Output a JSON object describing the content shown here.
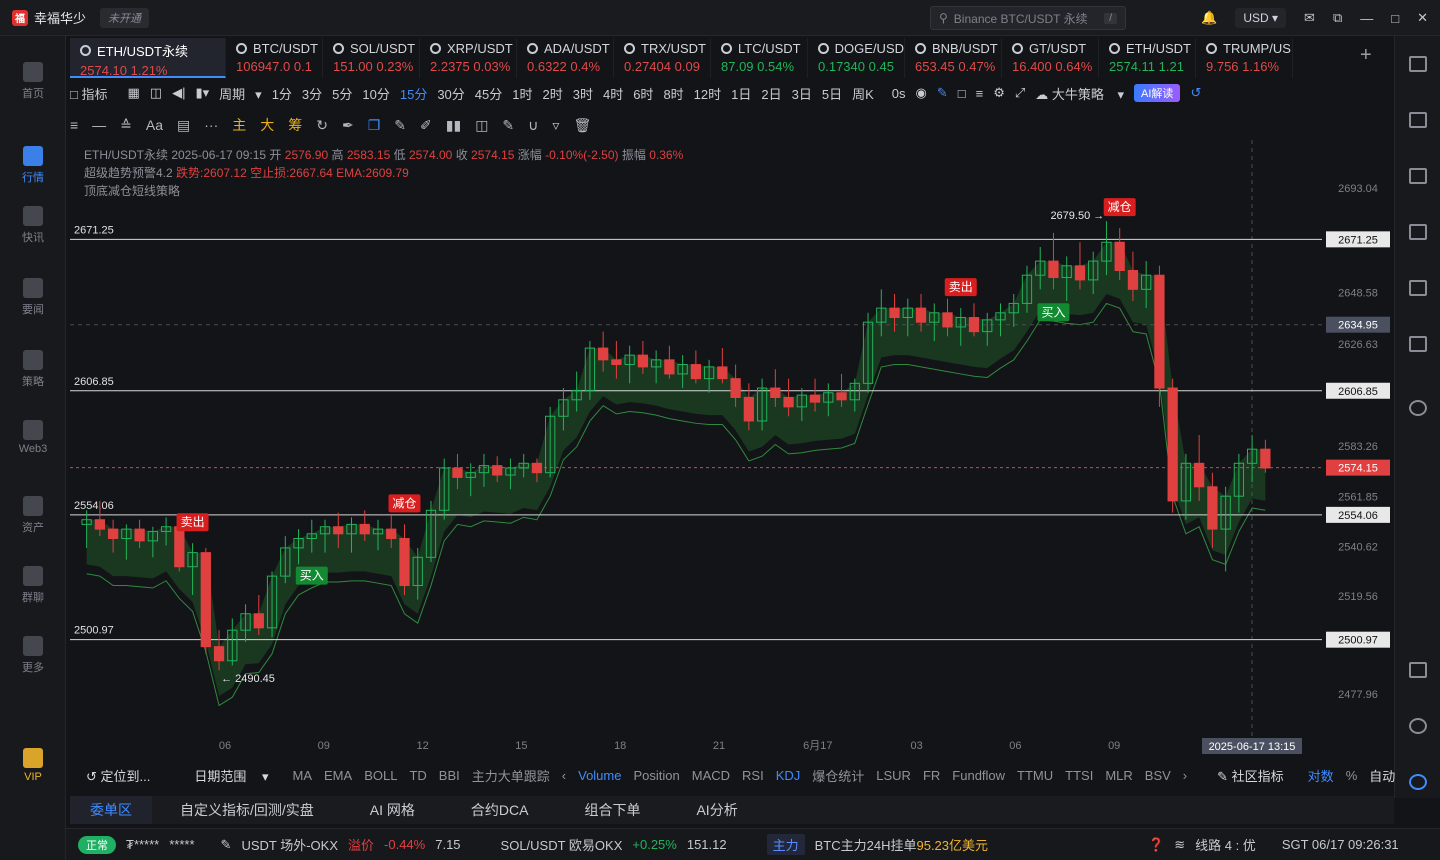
{
  "app": {
    "name": "幸福华少",
    "status_badge": "未开通",
    "search_placeholder": "Binance BTC/USDT 永续",
    "search_shortcut": "/",
    "currency": "USD"
  },
  "sidebar": [
    {
      "label": "首页"
    },
    {
      "label": "行情"
    },
    {
      "label": "快讯"
    },
    {
      "label": "要闻"
    },
    {
      "label": "策略"
    },
    {
      "label": "Web3"
    },
    {
      "label": "资产"
    },
    {
      "label": "群聊"
    },
    {
      "label": "更多"
    },
    {
      "label": "VIP"
    }
  ],
  "tickers": [
    {
      "name": "ETH/USDT永续",
      "price": "2574.10",
      "change": "1.21%",
      "dir": "down"
    },
    {
      "name": "BTC/USDT",
      "price": "106947.0",
      "change": "0.1",
      "dir": "down"
    },
    {
      "name": "SOL/USDT",
      "price": "151.00",
      "change": "0.23%",
      "dir": "down"
    },
    {
      "name": "XRP/USDT",
      "price": "2.2375",
      "change": "0.03%",
      "dir": "down"
    },
    {
      "name": "ADA/USDT",
      "price": "0.6322",
      "change": "0.4%",
      "dir": "down"
    },
    {
      "name": "TRX/USDT",
      "price": "0.27404",
      "change": "0.09",
      "dir": "down"
    },
    {
      "name": "LTC/USDT",
      "price": "87.09",
      "change": "0.54%",
      "dir": "up"
    },
    {
      "name": "DOGE/USD",
      "price": "0.17340",
      "change": "0.45",
      "dir": "up"
    },
    {
      "name": "BNB/USDT",
      "price": "653.45",
      "change": "0.47%",
      "dir": "down"
    },
    {
      "name": "GT/USDT",
      "price": "16.400",
      "change": "0.64%",
      "dir": "down"
    },
    {
      "name": "ETH/USDT",
      "price": "2574.11",
      "change": "1.21",
      "dir": "up"
    },
    {
      "name": "TRUMP/US",
      "price": "9.756",
      "change": "1.16%",
      "dir": "down"
    }
  ],
  "toolbar": {
    "indicator": "指标",
    "period": "周期",
    "intervals": [
      "1分",
      "3分",
      "5分",
      "10分",
      "15分",
      "30分",
      "45分",
      "1时",
      "2时",
      "3时",
      "4时",
      "6时",
      "8时",
      "12时",
      "1日",
      "2日",
      "3日",
      "5日",
      "周K"
    ],
    "active_interval": "15分",
    "countdown": "0s",
    "strategy": "大牛策略",
    "ai": "AI解读"
  },
  "drawing_tools": [
    "主",
    "大",
    "筹"
  ],
  "legend": {
    "line1": "ETH/USDT永续 2025-06-17 09:15 开",
    "open": "2576.90",
    "high_label": "高",
    "high": "2583.15",
    "low_label": "低",
    "low": "2574.00",
    "close_label": "收",
    "close": "2574.15",
    "amp_label": "涨幅",
    "amp": "-0.10%(-2.50)",
    "swing_label": "振幅",
    "swing": "0.36%",
    "line2": "超级趋势预警4.2",
    "trail": "跌势:2607.12 空止损:2667.64 EMA:2609.79",
    "line3": "顶底减仓短线策略"
  },
  "chart_data": {
    "type": "candlestick",
    "ylim": [
      2460,
      2705
    ],
    "y_ticks": [
      2693.04,
      2648.58,
      2626.63,
      2583.26,
      2561.85,
      2540.62,
      2519.56,
      2477.96
    ],
    "x_ticks": [
      "06",
      "09",
      "12",
      "15",
      "18",
      "21",
      "6月17",
      "03",
      "06",
      "09"
    ],
    "hlines": [
      2671.25,
      2606.85,
      2554.06,
      2500.97
    ],
    "current_price": "2574.15",
    "crosshair_price": "2634.95",
    "crosshair_time": "2025-06-17 13:15",
    "high_label": "2679.50 →",
    "low_label": "← 2490.45",
    "signals": [
      {
        "label": "卖出",
        "kind": "sell",
        "index": 8
      },
      {
        "label": "减仓",
        "kind": "sell",
        "index": 24
      },
      {
        "label": "买入",
        "kind": "buy",
        "index": 17
      },
      {
        "label": "卖出",
        "kind": "sell",
        "index": 66
      },
      {
        "label": "减仓",
        "kind": "sell",
        "index": 78
      },
      {
        "label": "买入",
        "kind": "buy",
        "index": 73
      },
      {
        "label": "卖出",
        "kind": "sell",
        "index": 104
      }
    ],
    "candles": [
      [
        2550,
        2556,
        2540,
        2552
      ],
      [
        2552,
        2560,
        2545,
        2548
      ],
      [
        2548,
        2552,
        2538,
        2544
      ],
      [
        2544,
        2550,
        2535,
        2548
      ],
      [
        2548,
        2552,
        2540,
        2543
      ],
      [
        2543,
        2549,
        2536,
        2547
      ],
      [
        2547,
        2553,
        2541,
        2549
      ],
      [
        2549,
        2552,
        2530,
        2532
      ],
      [
        2532,
        2542,
        2520,
        2538
      ],
      [
        2538,
        2540,
        2495,
        2498
      ],
      [
        2498,
        2505,
        2488,
        2492
      ],
      [
        2492,
        2510,
        2490,
        2505
      ],
      [
        2505,
        2516,
        2500,
        2512
      ],
      [
        2512,
        2520,
        2503,
        2506
      ],
      [
        2506,
        2530,
        2502,
        2528
      ],
      [
        2528,
        2545,
        2525,
        2540
      ],
      [
        2540,
        2548,
        2533,
        2544
      ],
      [
        2544,
        2552,
        2538,
        2546
      ],
      [
        2546,
        2552,
        2538,
        2549
      ],
      [
        2549,
        2555,
        2540,
        2546
      ],
      [
        2546,
        2553,
        2538,
        2550
      ],
      [
        2550,
        2556,
        2543,
        2546
      ],
      [
        2546,
        2552,
        2539,
        2548
      ],
      [
        2548,
        2554,
        2540,
        2544
      ],
      [
        2544,
        2550,
        2520,
        2524
      ],
      [
        2524,
        2540,
        2518,
        2536
      ],
      [
        2536,
        2560,
        2534,
        2556
      ],
      [
        2556,
        2578,
        2552,
        2574
      ],
      [
        2574,
        2580,
        2565,
        2570
      ],
      [
        2570,
        2576,
        2562,
        2572
      ],
      [
        2572,
        2580,
        2566,
        2575
      ],
      [
        2575,
        2579,
        2568,
        2571
      ],
      [
        2571,
        2578,
        2565,
        2574
      ],
      [
        2574,
        2580,
        2570,
        2576
      ],
      [
        2576,
        2578,
        2568,
        2572
      ],
      [
        2572,
        2600,
        2570,
        2596
      ],
      [
        2596,
        2608,
        2590,
        2603
      ],
      [
        2603,
        2615,
        2598,
        2607
      ],
      [
        2607,
        2628,
        2603,
        2625
      ],
      [
        2625,
        2632,
        2615,
        2620
      ],
      [
        2620,
        2628,
        2612,
        2618
      ],
      [
        2618,
        2626,
        2610,
        2622
      ],
      [
        2622,
        2628,
        2614,
        2617
      ],
      [
        2617,
        2624,
        2610,
        2620
      ],
      [
        2620,
        2626,
        2612,
        2614
      ],
      [
        2614,
        2622,
        2608,
        2618
      ],
      [
        2618,
        2624,
        2610,
        2612
      ],
      [
        2612,
        2620,
        2606,
        2617
      ],
      [
        2617,
        2625,
        2610,
        2612
      ],
      [
        2612,
        2618,
        2600,
        2604
      ],
      [
        2604,
        2610,
        2590,
        2594
      ],
      [
        2594,
        2612,
        2590,
        2608
      ],
      [
        2608,
        2616,
        2600,
        2604
      ],
      [
        2604,
        2612,
        2596,
        2600
      ],
      [
        2600,
        2608,
        2594,
        2605
      ],
      [
        2605,
        2612,
        2598,
        2602
      ],
      [
        2602,
        2610,
        2596,
        2606
      ],
      [
        2606,
        2614,
        2600,
        2603
      ],
      [
        2603,
        2612,
        2598,
        2610
      ],
      [
        2610,
        2640,
        2606,
        2636
      ],
      [
        2636,
        2650,
        2630,
        2642
      ],
      [
        2642,
        2648,
        2632,
        2638
      ],
      [
        2638,
        2646,
        2630,
        2642
      ],
      [
        2642,
        2648,
        2632,
        2636
      ],
      [
        2636,
        2644,
        2628,
        2640
      ],
      [
        2640,
        2646,
        2630,
        2634
      ],
      [
        2634,
        2642,
        2626,
        2638
      ],
      [
        2638,
        2644,
        2630,
        2632
      ],
      [
        2632,
        2640,
        2626,
        2637
      ],
      [
        2637,
        2644,
        2630,
        2640
      ],
      [
        2640,
        2648,
        2634,
        2644
      ],
      [
        2644,
        2660,
        2640,
        2656
      ],
      [
        2656,
        2668,
        2650,
        2662
      ],
      [
        2662,
        2674,
        2650,
        2655
      ],
      [
        2655,
        2664,
        2645,
        2660
      ],
      [
        2660,
        2670,
        2650,
        2654
      ],
      [
        2654,
        2666,
        2648,
        2662
      ],
      [
        2662,
        2679,
        2656,
        2670
      ],
      [
        2670,
        2676,
        2654,
        2658
      ],
      [
        2658,
        2666,
        2645,
        2650
      ],
      [
        2650,
        2662,
        2642,
        2656
      ],
      [
        2656,
        2660,
        2600,
        2608
      ],
      [
        2608,
        2612,
        2555,
        2560
      ],
      [
        2560,
        2580,
        2552,
        2576
      ],
      [
        2576,
        2588,
        2560,
        2566
      ],
      [
        2566,
        2572,
        2540,
        2548
      ],
      [
        2548,
        2566,
        2530,
        2562
      ],
      [
        2562,
        2580,
        2555,
        2576
      ],
      [
        2576,
        2588,
        2568,
        2582
      ],
      [
        2582,
        2586,
        2572,
        2574
      ]
    ]
  },
  "bottom_indicators": {
    "locate": "定位到...",
    "range": "日期范围",
    "items": [
      "MA",
      "EMA",
      "BOLL",
      "TD",
      "BBI",
      "主力大单跟踪"
    ],
    "sub_items": [
      "Volume",
      "Position",
      "MACD",
      "RSI",
      "KDJ",
      "爆仓统计",
      "LSUR",
      "FR",
      "Fundflow",
      "TTMU",
      "TTSI",
      "MLR",
      "BSV"
    ],
    "active": [
      "Volume",
      "KDJ"
    ],
    "community": "社区指标",
    "log_label": "对数",
    "pct": "%",
    "auto": "自动"
  },
  "bottom_tabs": [
    "委单区",
    "自定义指标/回测/实盘",
    "AI 网格",
    "合约DCA",
    "组合下单",
    "AI分析"
  ],
  "status": {
    "connection": "正常",
    "masked1": "₮*****",
    "masked2": "*****",
    "ticker1": "USDT 场外-OKX",
    "premium_label": "溢价",
    "premium": "-0.44%",
    "premium_price": "7.15",
    "ticker2": "SOL/USDT 欧易OKX",
    "ticker2_change": "+0.25%",
    "ticker2_price": "151.12",
    "main_badge": "主力",
    "main_text": "BTC主力24H挂单",
    "main_value": "95.23亿美元",
    "line": "线路 4 : 优",
    "clock": "SGT 06/17 09:26:31"
  }
}
